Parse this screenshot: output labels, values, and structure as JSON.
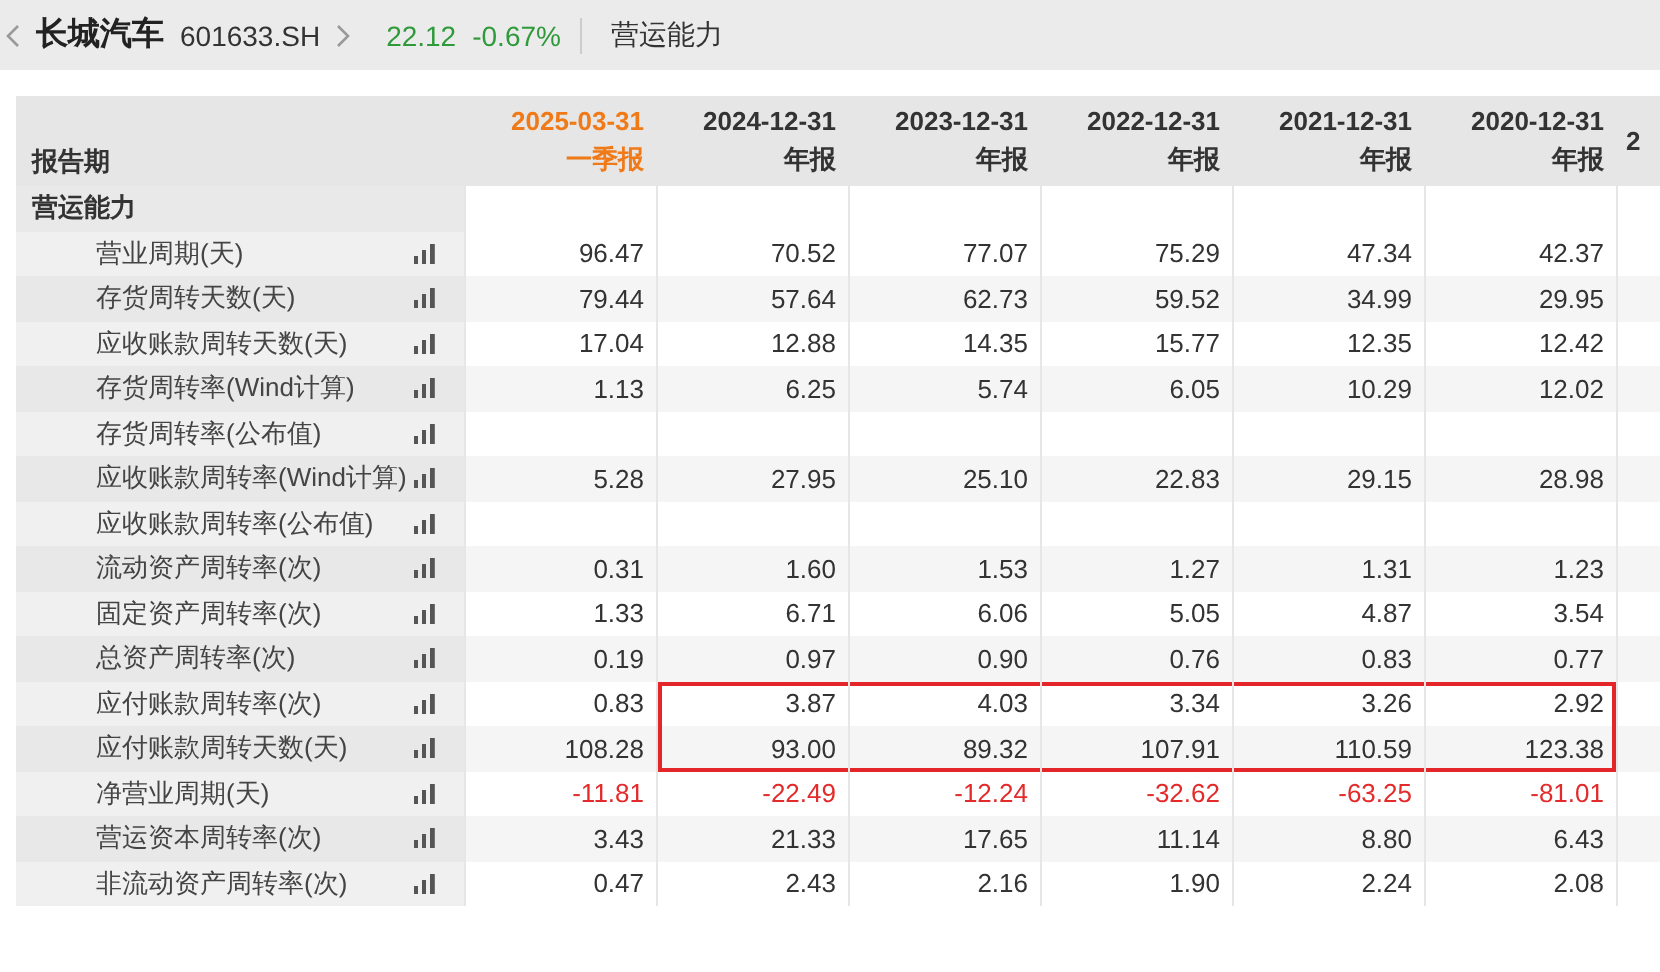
{
  "header": {
    "name": "长城汽车",
    "code": "601633.SH",
    "price": "22.12",
    "change": "-0.67%",
    "section": "营运能力"
  },
  "table": {
    "corner": "报告期",
    "columns": [
      {
        "date": "2025-03-31",
        "period": "一季报",
        "emphasis": true,
        "boxed": false
      },
      {
        "date": "2024-12-31",
        "period": "年报",
        "emphasis": false,
        "boxed": true
      },
      {
        "date": "2023-12-31",
        "period": "年报",
        "emphasis": false,
        "boxed": true
      },
      {
        "date": "2022-12-31",
        "period": "年报",
        "emphasis": false,
        "boxed": true
      },
      {
        "date": "2021-12-31",
        "period": "年报",
        "emphasis": false,
        "boxed": true
      },
      {
        "date": "2020-12-31",
        "period": "年报",
        "emphasis": false,
        "boxed": true
      },
      {
        "date": "2",
        "emphasis": false,
        "boxed": false
      }
    ],
    "rows": [
      {
        "kind": "section",
        "label": "营运能力"
      },
      {
        "kind": "data",
        "label": "营业周期(天)",
        "negative": false,
        "boxed": false,
        "values": [
          "96.47",
          "70.52",
          "77.07",
          "75.29",
          "47.34",
          "42.37"
        ]
      },
      {
        "kind": "data",
        "label": "存货周转天数(天)",
        "negative": false,
        "boxed": false,
        "values": [
          "79.44",
          "57.64",
          "62.73",
          "59.52",
          "34.99",
          "29.95"
        ]
      },
      {
        "kind": "data",
        "label": "应收账款周转天数(天)",
        "negative": false,
        "boxed": false,
        "values": [
          "17.04",
          "12.88",
          "14.35",
          "15.77",
          "12.35",
          "12.42"
        ]
      },
      {
        "kind": "data",
        "label": "存货周转率(Wind计算)",
        "negative": false,
        "boxed": false,
        "values": [
          "1.13",
          "6.25",
          "5.74",
          "6.05",
          "10.29",
          "12.02"
        ]
      },
      {
        "kind": "data",
        "label": "存货周转率(公布值)",
        "boxed": false
      },
      {
        "kind": "data",
        "label": "应收账款周转率(Wind计算)",
        "negative": false,
        "boxed": false,
        "values": [
          "5.28",
          "27.95",
          "25.10",
          "22.83",
          "29.15",
          "28.98"
        ]
      },
      {
        "kind": "data",
        "label": "应收账款周转率(公布值)",
        "boxed": false
      },
      {
        "kind": "data",
        "label": "流动资产周转率(次)",
        "negative": false,
        "boxed": false,
        "values": [
          "0.31",
          "1.60",
          "1.53",
          "1.27",
          "1.31",
          "1.23"
        ]
      },
      {
        "kind": "data",
        "label": "固定资产周转率(次)",
        "negative": false,
        "boxed": false,
        "values": [
          "1.33",
          "6.71",
          "6.06",
          "5.05",
          "4.87",
          "3.54"
        ]
      },
      {
        "kind": "data",
        "label": "总资产周转率(次)",
        "negative": false,
        "boxed": false,
        "values": [
          "0.19",
          "0.97",
          "0.90",
          "0.76",
          "0.83",
          "0.77"
        ]
      },
      {
        "kind": "data",
        "label": "应付账款周转率(次)",
        "negative": false,
        "boxed": true,
        "values": [
          "0.83",
          "3.87",
          "4.03",
          "3.34",
          "3.26",
          "2.92"
        ]
      },
      {
        "kind": "data",
        "label": "应付账款周转天数(天)",
        "negative": false,
        "boxed": true,
        "values": [
          "108.28",
          "93.00",
          "89.32",
          "107.91",
          "110.59",
          "123.38"
        ]
      },
      {
        "kind": "data",
        "label": "净营业周期(天)",
        "negative": true,
        "boxed": false,
        "values": [
          "-11.81",
          "-22.49",
          "-12.24",
          "-32.62",
          "-63.25",
          "-81.01"
        ]
      },
      {
        "kind": "data",
        "label": "营运资本周转率(次)",
        "negative": false,
        "boxed": false,
        "values": [
          "3.43",
          "21.33",
          "17.65",
          "11.14",
          "8.80",
          "6.43"
        ]
      },
      {
        "kind": "data",
        "label": "非流动资产周转率(次)",
        "negative": false,
        "boxed": false,
        "values": [
          "0.47",
          "2.43",
          "2.16",
          "1.90",
          "2.24",
          "2.08"
        ]
      }
    ]
  }
}
